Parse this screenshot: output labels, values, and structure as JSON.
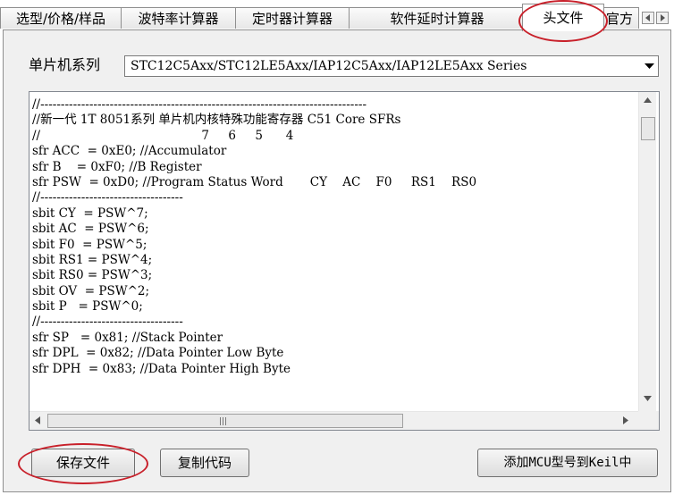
{
  "tabs": [
    {
      "label": "选型/价格/样品",
      "active": false
    },
    {
      "label": "波特率计算器",
      "active": false
    },
    {
      "label": "定时器计算器",
      "active": false
    },
    {
      "label": "软件延时计算器",
      "active": false
    },
    {
      "label": "头文件",
      "active": true
    },
    {
      "label": "官方",
      "active": false
    }
  ],
  "series": {
    "label": "单片机系列",
    "value": "STC12C5Axx/STC12LE5Axx/IAP12C5Axx/IAP12LE5Axx Series"
  },
  "code": {
    "lines": [
      "//--------------------------------------------------------------------------------",
      "//新一代 1T 8051系列 单片机内核特殊功能寄存器 C51 Core SFRs",
      "//                                          7     6     5      4",
      "sfr ACC  = 0xE0; //Accumulator",
      "sfr B    = 0xF0; //B Register",
      "sfr PSW  = 0xD0; //Program Status Word       CY    AC    F0     RS1    RS0",
      "//-----------------------------------",
      "sbit CY  = PSW^7;",
      "sbit AC  = PSW^6;",
      "sbit F0  = PSW^5;",
      "sbit RS1 = PSW^4;",
      "sbit RS0 = PSW^3;",
      "sbit OV  = PSW^2;",
      "sbit P   = PSW^0;",
      "//-----------------------------------",
      "sfr SP   = 0x81; //Stack Pointer",
      "sfr DPL  = 0x82; //Data Pointer Low Byte",
      "sfr DPH  = 0x83; //Data Pointer High Byte"
    ]
  },
  "buttons": {
    "save": "保存文件",
    "copy": "复制代码",
    "add_keil": "添加MCU型号到Keil中"
  },
  "colors": {
    "annotation": "#c8202a",
    "window_bg": "#f0f0f0"
  }
}
